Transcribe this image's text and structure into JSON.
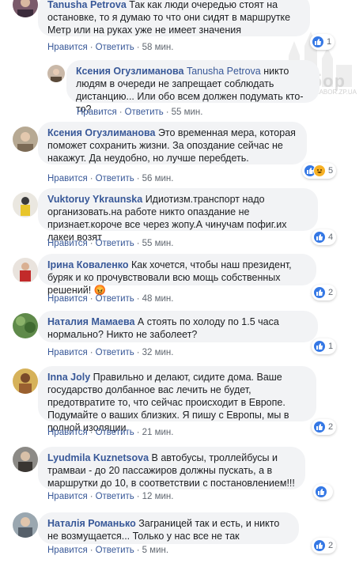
{
  "watermark": {
    "text": "Забор",
    "url": "WWW.ZABOR.ZP.UA"
  },
  "labels": {
    "reply": "Ответить",
    "like": "Нравится"
  },
  "comments": [
    {
      "author": "Tanusha Petrova",
      "text": "Так как люди очередью стоят на остановке, то я думаю то что они сидят в маршрутке Метр или на руках уже не имеет значения",
      "time": "58 мин.",
      "reactions": [
        "like"
      ],
      "reaction_count": "1"
    },
    {
      "author": "Ксения Огузлиманова",
      "mention": "Tanusha Petrova",
      "text": "никто людям в очереди не запрещает соблюдать дистанцию... Или обо всем должен подумать кто-то?",
      "time": "55 мин.",
      "reactions": [],
      "reaction_count": ""
    },
    {
      "author": "Ксения Огузлиманова",
      "text": "Это временная мера, которая поможет сохранить жизни. За опоздание сейчас не накажут. Да неудобно, но лучше перебдеть.",
      "time": "56 мин.",
      "reactions": [
        "like",
        "haha"
      ],
      "reaction_count": "5"
    },
    {
      "author": "Vuktoruy Ykraunska",
      "text": "Идиотизм.транспорт надо организовать.на работе никто опаздание не признает.короче все через жопу.А чинучам пофиг.их лакеи возят",
      "time": "55 мин.",
      "reactions": [
        "like"
      ],
      "reaction_count": "4"
    },
    {
      "author": "Ірина Коваленко",
      "text": "Как хочется, чтобы наш президент, буряк и ко прочувствовали всю мощь собственных решений! 😡",
      "time": "48 мин.",
      "reactions": [
        "like"
      ],
      "reaction_count": "2"
    },
    {
      "author": "Наталия Мамаева",
      "text": "А стоять по холоду по 1.5 часа нормально? Никто не заболеет?",
      "time": "32 мин.",
      "reactions": [
        "like"
      ],
      "reaction_count": "1"
    },
    {
      "author": "Inna Joly",
      "text": "Правильно и делают, сидите дома. Ваше государство долбанное вас лечить не будет, предотвратите то, что сейчас происходит в Европе. Подумайте о ваших близких. Я пишу с Европы, мы в полной изоляции",
      "time": "21 мин.",
      "reactions": [
        "like"
      ],
      "reaction_count": "2"
    },
    {
      "author": "Lyudmila Kuznetsova",
      "text": "В автобусы, троллейбусы и трамваи - до 20 пассажиров должны пускать, а в маршрутки до 10, в соответствии с постановлением!!!",
      "time": "12 мин.",
      "reactions": [
        "like"
      ],
      "reaction_count": ""
    },
    {
      "author": "Наталія Романько",
      "text": "Заграницей так и есть, и никто не возмущается... Только у нас все не так",
      "time": "5 мин.",
      "reactions": [
        "like"
      ],
      "reaction_count": "2"
    }
  ]
}
